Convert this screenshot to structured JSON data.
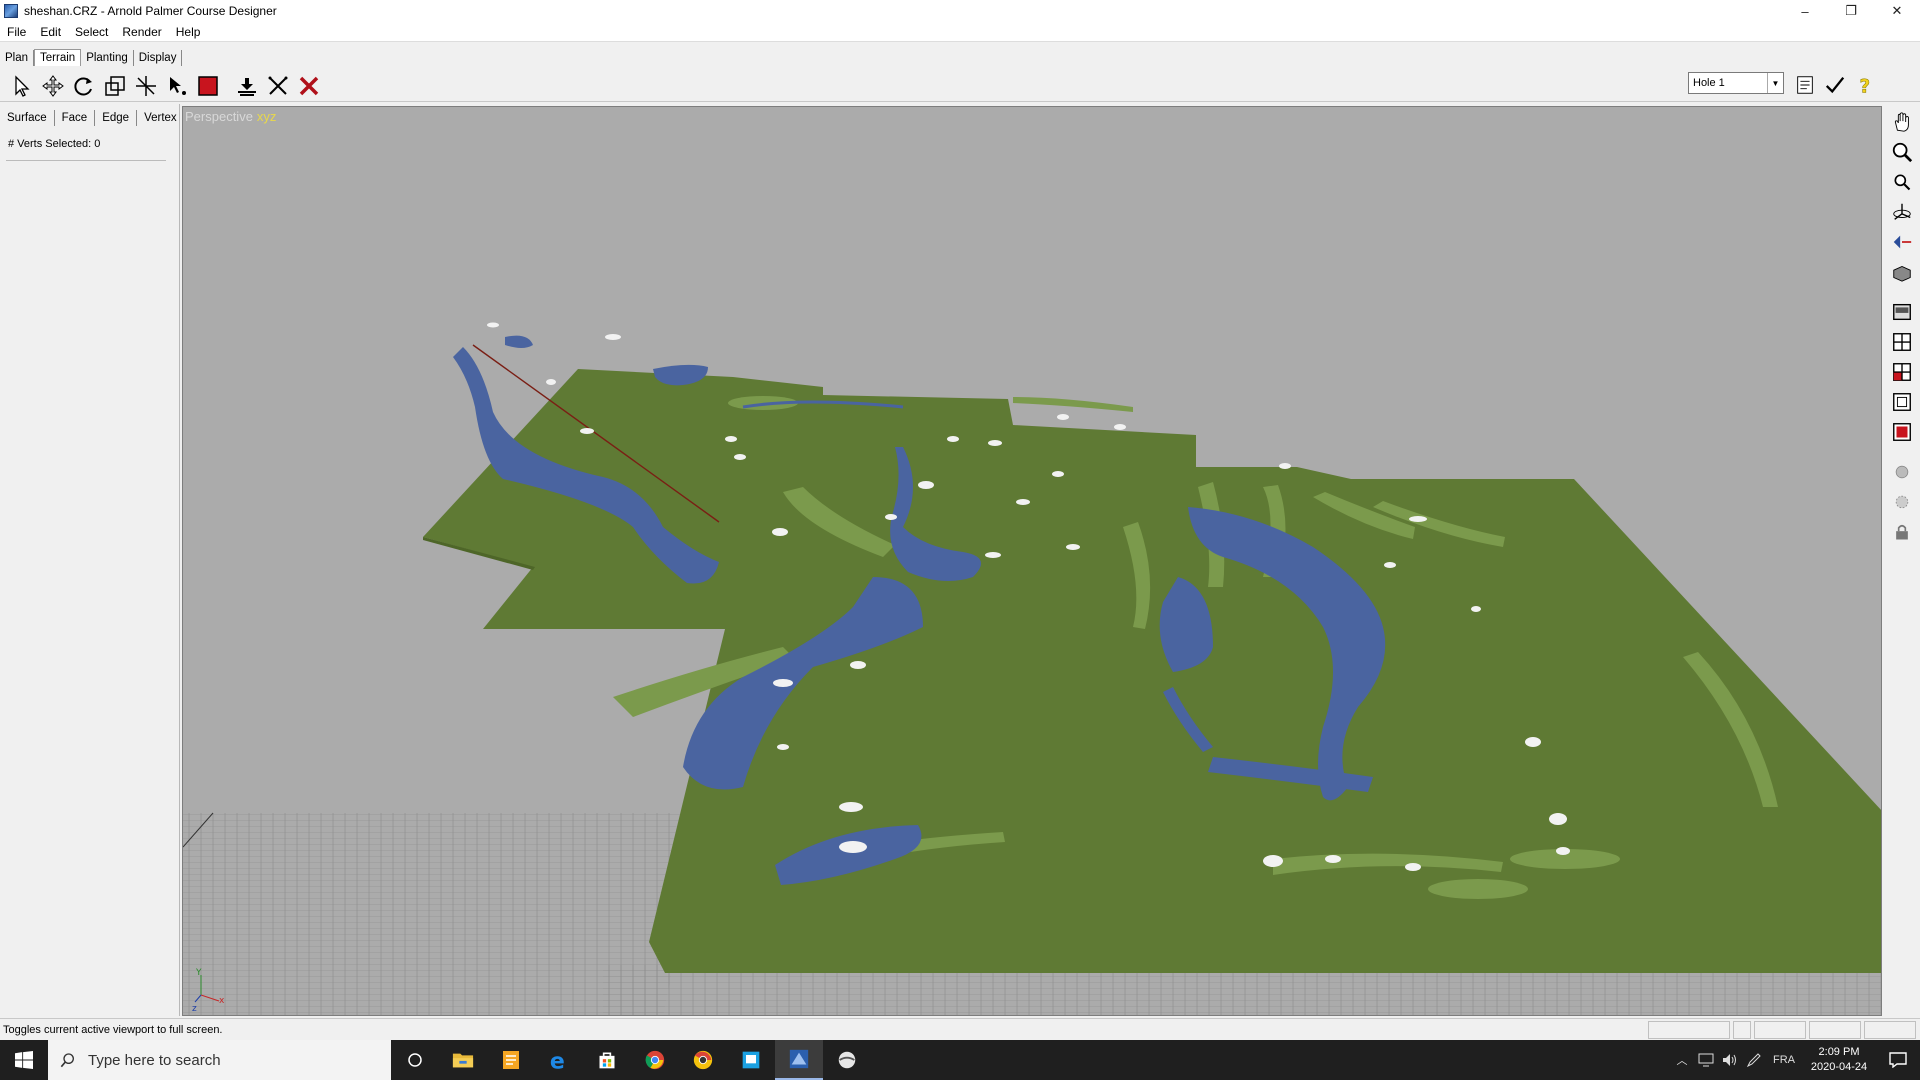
{
  "window": {
    "title": "sheshan.CRZ - Arnold Palmer Course Designer",
    "min": "–",
    "max": "❐",
    "close": "✕"
  },
  "menu": [
    "File",
    "Edit",
    "Select",
    "Render",
    "Help"
  ],
  "mode_tabs": [
    "Plan",
    "Terrain",
    "Planting",
    "Display"
  ],
  "active_mode": "Terrain",
  "toolbar": {
    "hole_select": "Hole 1",
    "tools": [
      "select-arrow-icon",
      "move-icon",
      "rotate-icon",
      "scale-icon",
      "split-icon",
      "select-vertex-icon",
      "red-square-icon",
      "flatten-icon",
      "cross-tool-icon",
      "delete-icon"
    ],
    "right_tools": [
      "notes-icon",
      "checkmark-icon",
      "help-icon"
    ]
  },
  "left_panel": {
    "subtabs": [
      "Surface",
      "Face",
      "Edge",
      "Vertex"
    ],
    "verts_selected": "# Verts Selected: 0"
  },
  "viewport": {
    "label": "Perspective",
    "axes_label": "xyz"
  },
  "vertical_toolbar": [
    "pan-hand-icon",
    "zoom-icon",
    "zoom-small-icon",
    "orbit-icon",
    "fly-icon",
    "camera-icon",
    "view-single-icon",
    "view-quad-icon",
    "view-red-icon",
    "fullscreen-icon",
    "fullscreen-red-icon",
    "sphere-icon",
    "sphere-outline-icon",
    "lock-icon"
  ],
  "status": {
    "message": "Toggles current active viewport to full screen."
  },
  "taskbar": {
    "search_placeholder": "Type here to search",
    "clock_time": "2:09 PM",
    "clock_date": "2020-04-24",
    "language": "FRA"
  },
  "colors": {
    "terrain": "#5f7a34",
    "fairway": "#7b9a4c",
    "water": "#4a64a0",
    "bunker": "#f0f0f0",
    "sky": "#ababab"
  }
}
